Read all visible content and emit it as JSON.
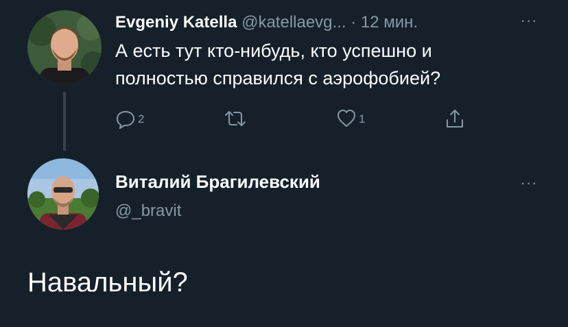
{
  "reply_to_tweet": {
    "author_name": "Evgeniy Katella",
    "author_handle": "@katellaevg...",
    "separator": " · ",
    "time_ago": "12 мин.",
    "more_label": "···",
    "text": "А есть тут кто-нибудь, кто успешно и полностью справился с аэрофобией?",
    "actions": {
      "reply_count": "2",
      "retweet_count": "",
      "like_count": "1"
    },
    "icons": {
      "reply": "reply-icon",
      "retweet": "retweet-icon",
      "like": "heart-icon",
      "share": "share-icon",
      "more": "more-icon"
    }
  },
  "main_tweet": {
    "author_name": "Виталий Брагилевский",
    "author_handle": "@_bravit",
    "more_label": "···",
    "text": "Навальный?"
  },
  "colors": {
    "background": "#15202b",
    "primary_text": "#ffffff",
    "secondary_text": "#8899a6",
    "thread_line": "#38444d"
  }
}
